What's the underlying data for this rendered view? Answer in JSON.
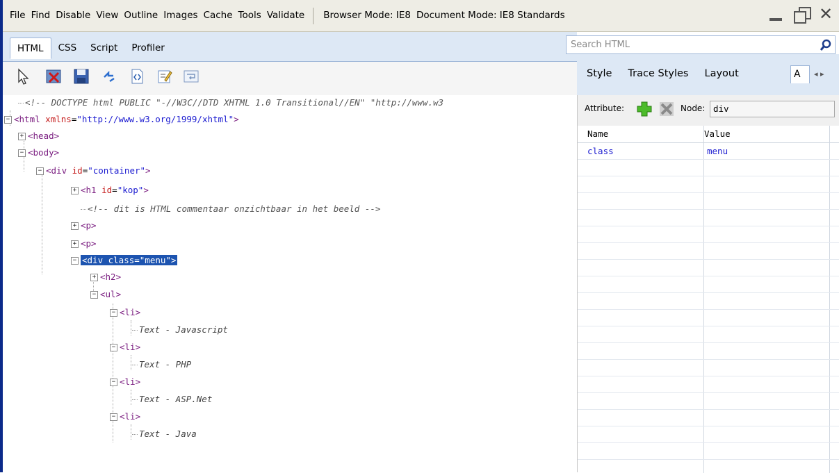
{
  "menubar": {
    "items": [
      "File",
      "Find",
      "Disable",
      "View",
      "Outline",
      "Images",
      "Cache",
      "Tools",
      "Validate"
    ],
    "browser_mode": "Browser Mode: IE8",
    "document_mode": "Document Mode: IE8 Standards"
  },
  "tabs": [
    "HTML",
    "CSS",
    "Script",
    "Profiler"
  ],
  "search": {
    "placeholder": "Search HTML"
  },
  "right_tabs": [
    "Style",
    "Trace Styles",
    "Layout"
  ],
  "right_tab_cut": "A",
  "attributes": {
    "label": "Attribute:",
    "node_label": "Node:",
    "node_value": "div",
    "columns": [
      "Name",
      "Value"
    ],
    "rows": [
      {
        "name": "class",
        "value": "menu"
      }
    ]
  },
  "tree": {
    "doctype": "<!-- DOCTYPE html PUBLIC \"-//W3C//DTD XHTML 1.0 Transitional//EN\" \"http://www.w3",
    "html_open": "<html",
    "html_attr": "xmlns",
    "html_val": "\"http://www.w3.org/1999/xhtml\"",
    "head": "<head>",
    "body": "<body>",
    "div_open": "<div",
    "div_attr": "id",
    "div_val": "\"container\"",
    "h1_open": "<h1",
    "h1_attr": "id",
    "h1_val": "\"kop\"",
    "comment": "<!--  dit is HTML commentaar onzichtbaar in het beeld -->",
    "p1": "<p>",
    "p2": "<p>",
    "selected": "<div class=\"menu\">",
    "h2": "<h2>",
    "ul": "<ul>",
    "li": "<li>",
    "items": [
      "Text - Javascript",
      "Text - PHP",
      "Text - ASP.Net",
      "Text - Java"
    ]
  }
}
